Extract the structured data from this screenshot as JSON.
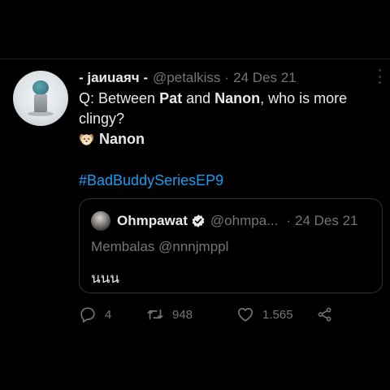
{
  "tweet": {
    "display_name": "- jaиuaяч -",
    "handle": "@petalkiss",
    "separator": "·",
    "date": "24 Des 21",
    "text_prefix": "Q: Between ",
    "text_name1": "Pat",
    "text_and": " and ",
    "text_name2": "Nanon",
    "text_suffix": ", who is more clingy?",
    "answer_emoji": "dog-face-icon",
    "answer": "Nanon",
    "hashtag": "#BadBuddySeriesEP9"
  },
  "quote": {
    "display_name": "Ohmpawat",
    "handle": "@ohmpa...",
    "separator": "·",
    "date": "24 Des 21",
    "reply_to": "Membalas @nnnjmppl",
    "text": "นนน"
  },
  "actions": {
    "replies": "4",
    "retweets": "948",
    "likes": "1.565"
  },
  "colors": {
    "background": "#000000",
    "text": "#e7e9ea",
    "muted": "#71767b",
    "accent": "#1d9bf0",
    "border": "#2f3336"
  }
}
